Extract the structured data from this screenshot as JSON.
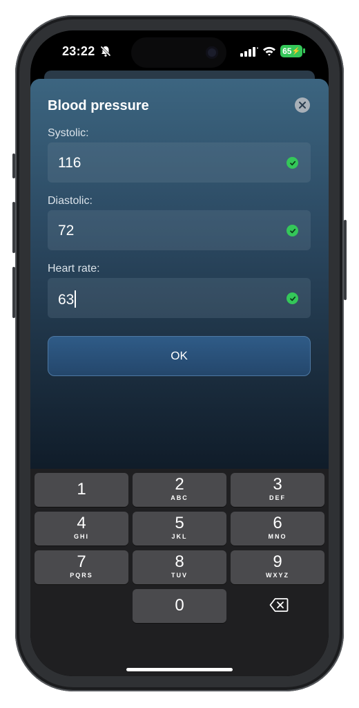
{
  "status_bar": {
    "time": "23:22",
    "battery": "65"
  },
  "sheet": {
    "title": "Blood pressure",
    "fields": [
      {
        "label": "Systolic:",
        "value": "116"
      },
      {
        "label": "Diastolic:",
        "value": "72"
      },
      {
        "label": "Heart rate:",
        "value": "63"
      }
    ],
    "ok_label": "OK"
  },
  "keypad": {
    "keys": [
      {
        "num": "1",
        "letters": ""
      },
      {
        "num": "2",
        "letters": "ABC"
      },
      {
        "num": "3",
        "letters": "DEF"
      },
      {
        "num": "4",
        "letters": "GHI"
      },
      {
        "num": "5",
        "letters": "JKL"
      },
      {
        "num": "6",
        "letters": "MNO"
      },
      {
        "num": "7",
        "letters": "PQRS"
      },
      {
        "num": "8",
        "letters": "TUV"
      },
      {
        "num": "9",
        "letters": "WXYZ"
      },
      {
        "num": "0",
        "letters": ""
      }
    ]
  },
  "colors": {
    "accent_green": "#34c759",
    "ok_button": "#2a5079"
  }
}
